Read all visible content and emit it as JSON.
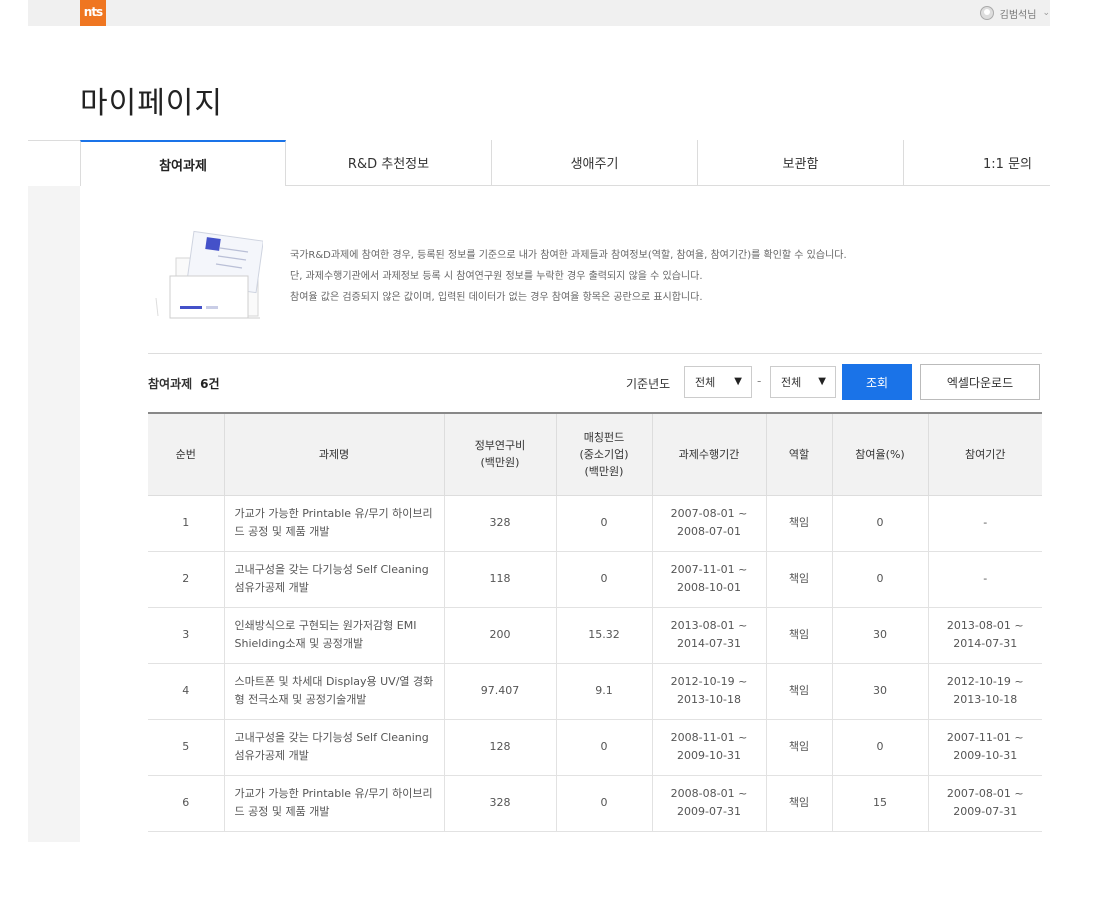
{
  "header": {
    "logo_text": "nts",
    "user_name": "김범석님"
  },
  "page": {
    "title": "마이페이지"
  },
  "tabs": [
    {
      "label": "참여과제",
      "active": true
    },
    {
      "label": "R&D 추천정보",
      "active": false
    },
    {
      "label": "생애주기",
      "active": false
    },
    {
      "label": "보관함",
      "active": false
    },
    {
      "label": "1:1 문의",
      "active": false
    }
  ],
  "info": {
    "lines": [
      "국가R&D과제에 참여한 경우, 등록된 정보를 기준으로 내가 참여한 과제들과 참여정보(역할, 참여율, 참여기간)를 확인할 수 있습니다.",
      "단, 과제수행기관에서 과제정보 등록 시 참여연구원 정보를 누락한 경우 출력되지 않을 수 있습니다.",
      "참여율 값은 검증되지 않은 값이며, 입력된 데이터가 없는 경우 참여율 항목은 공란으로 표시합니다."
    ]
  },
  "controls": {
    "count_label": "참여과제",
    "count_value": "6건",
    "year_label": "기준년도",
    "year_from": "전체",
    "year_to": "전체",
    "dash": "-",
    "search_button": "조회",
    "excel_button": "엑셀다운로드"
  },
  "table": {
    "headers": [
      "순번",
      "과제명",
      "정부연구비\n(백만원)",
      "매칭펀드\n(중소기업)\n(백만원)",
      "과제수행기간",
      "역할",
      "참여율(%)",
      "참여기간"
    ],
    "rows": [
      [
        "1",
        "가교가 가능한 Printable 유/무기 하이브리드 공정 및 제품 개발",
        "328",
        "0",
        "2007-08-01 ~\n2008-07-01",
        "책임",
        "0",
        "-"
      ],
      [
        "2",
        "고내구성을 갖는 다기능성 Self Cleaning 섬유가공제 개발",
        "118",
        "0",
        "2007-11-01 ~\n2008-10-01",
        "책임",
        "0",
        "-"
      ],
      [
        "3",
        "인쇄방식으로 구현되는 원가저감형 EMI Shielding소재 및 공정개발",
        "200",
        "15.32",
        "2013-08-01 ~\n2014-07-31",
        "책임",
        "30",
        "2013-08-01 ~\n2014-07-31"
      ],
      [
        "4",
        "스마트폰 및 차세대 Display용 UV/열 경화형 전극소재 및 공정기술개발",
        "97.407",
        "9.1",
        "2012-10-19 ~\n2013-10-18",
        "책임",
        "30",
        "2012-10-19 ~\n2013-10-18"
      ],
      [
        "5",
        "고내구성을 갖는 다기능성 Self Cleaning 섬유가공제 개발",
        "128",
        "0",
        "2008-11-01 ~\n2009-10-31",
        "책임",
        "0",
        "2007-11-01 ~\n2009-10-31"
      ],
      [
        "6",
        "가교가 가능한 Printable 유/무기 하이브리드 공정 및 제품 개발",
        "328",
        "0",
        "2008-08-01 ~\n2009-07-31",
        "책임",
        "15",
        "2007-08-01 ~\n2009-07-31"
      ]
    ]
  }
}
